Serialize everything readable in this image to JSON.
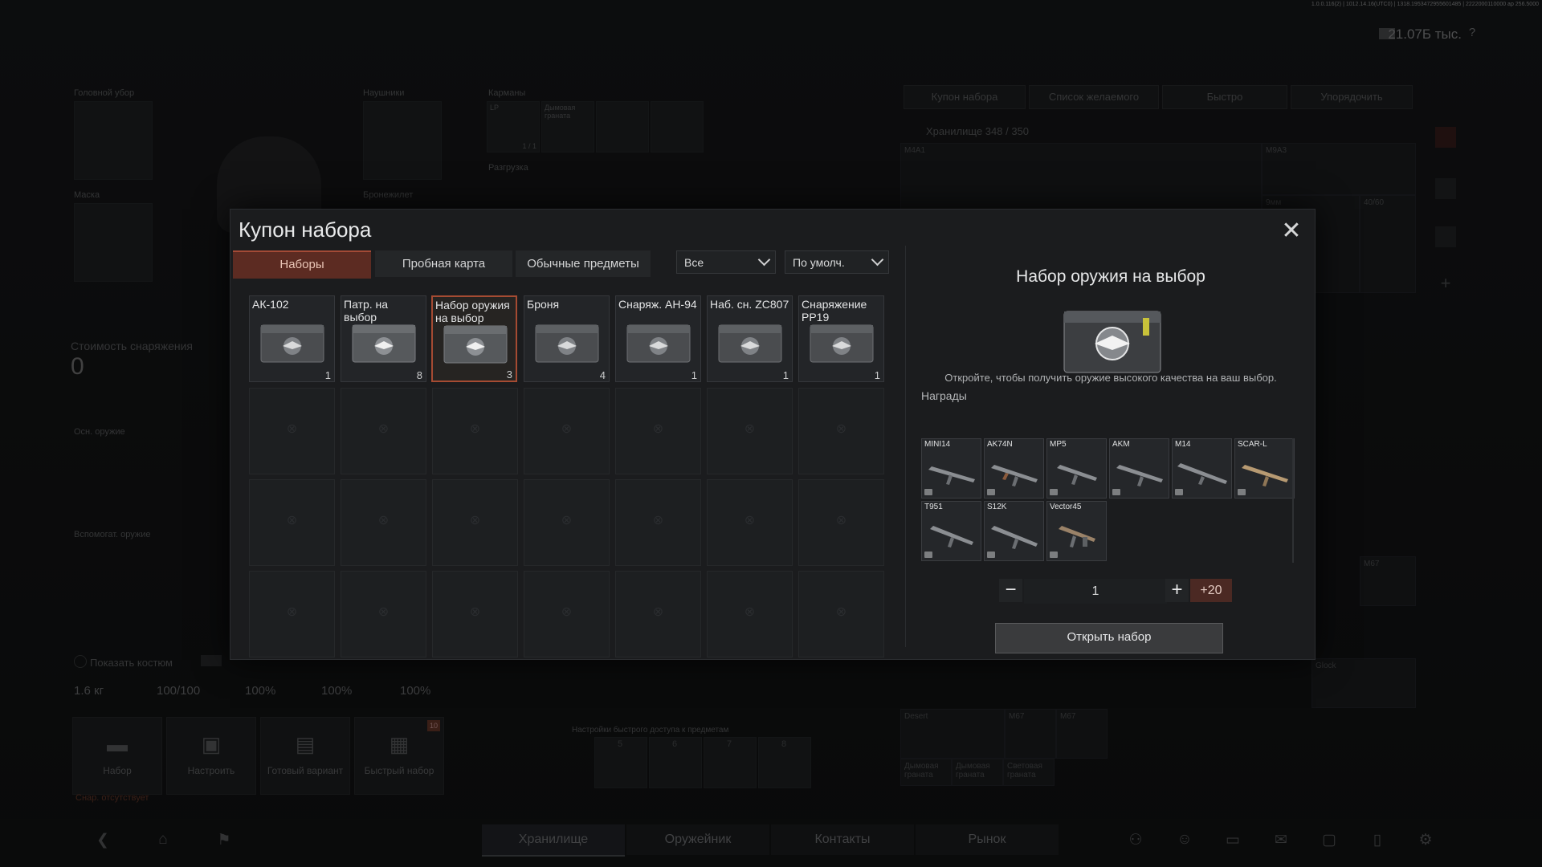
{
  "hud": {
    "build_info": "1.0.0.116(2) | 1012.14.16(UTC0) | 1318.1953472955601485 | 2222000110000 ap 256.5000",
    "currency": "21.07Б тыс.",
    "help": "?"
  },
  "background": {
    "slots": {
      "headwear": "Головной убор",
      "headphones": "Наушники",
      "pockets": "Карманы",
      "mask": "Маска",
      "armor": "Бронежилет",
      "rig": "Разгрузка",
      "primary": "Осн. оружие",
      "secondary": "Вспомогат. оружие",
      "pocket_item_1": "LP",
      "pocket_item_1_count": "1 / 1",
      "pocket_item_2": "Дымовая граната"
    },
    "equip_value_label": "Стоимость снаряжения",
    "equip_value": "0",
    "hide_costume": "Показать костюм",
    "stats": {
      "weight": "1.6 кг",
      "durability": "100/100",
      "s1": "100%",
      "s2": "100%",
      "s3": "100%"
    },
    "actions": [
      "Набор",
      "Настроить",
      "Готовый вариант",
      "Быстрый набор"
    ],
    "action_badge": "10",
    "missing_kit": "Снар. отсутствует",
    "quick_access_label": "Настройки быстрого доступа к предметам",
    "quick_numbers": [
      "5",
      "6",
      "7",
      "8"
    ],
    "stash_buttons": [
      "Купон набора",
      "Список желаемого",
      "Быстро",
      "Упорядочить"
    ],
    "storage": "Хранилище 348 / 350",
    "stash_items": [
      "M4A1",
      "M9A3",
      "9мм",
      "40/60",
      "M67",
      "Desert",
      "M67",
      "M67",
      "Дымовая граната",
      "Дымовая граната",
      "Световая граната",
      "Glock"
    ],
    "nav_tabs": [
      "Хранилище",
      "Оружейник",
      "Контакты",
      "Рынок"
    ]
  },
  "modal": {
    "title": "Купон набора",
    "tabs": [
      "Наборы",
      "Пробная карта",
      "Обычные предметы"
    ],
    "filter": "Все",
    "sort": "По умолч.",
    "kits": [
      {
        "name": "АК-102",
        "count": "1"
      },
      {
        "name": "Патр. на выбор",
        "count": "8"
      },
      {
        "name": "Набор оружия на выбор",
        "count": "3"
      },
      {
        "name": "Броня",
        "count": "4"
      },
      {
        "name": "Снаряж. АН-94",
        "count": "1"
      },
      {
        "name": "Наб. сн. ZC807",
        "count": "1"
      },
      {
        "name": "Снаряжение PP19",
        "count": "1"
      }
    ],
    "detail": {
      "title": "Набор оружия на выбор",
      "description": "Откройте, чтобы получить оружие высокого качества на ваш выбор.",
      "rewards_label": "Награды",
      "rewards": [
        "MINI14",
        "AK74N",
        "MP5",
        "AKM",
        "M14",
        "SCAR-L",
        "T951",
        "S12K",
        "Vector45"
      ],
      "quantity": "1",
      "minus": "−",
      "plus": "+",
      "plus20": "+20",
      "open_button": "Открыть набор"
    }
  },
  "colors": {
    "accent_tab": "#5c2b22",
    "accent_border": "#a54b32",
    "plus20_bg": "#4b2923"
  },
  "icons": [
    "close-icon",
    "chevron-down-icon",
    "crate-icon",
    "rifle-icon",
    "back-icon",
    "home-icon",
    "flag-icon",
    "help-icon",
    "currency-icon"
  ]
}
